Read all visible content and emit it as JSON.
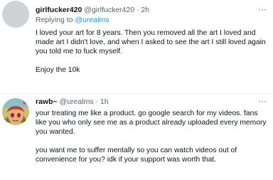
{
  "tweet1": {
    "display_name": "girlfucker420",
    "handle": "@girlfucker420",
    "separator": "·",
    "time": "2h",
    "replying_prefix": "Replying to",
    "replying_to": "@urealms",
    "paragraphs": [
      "I loved your art for 8 years. Then you removed all the art I loved and made art I didn't love, and when I asked to see the art I still loved again you told me to fuck myself.",
      "Enjoy the 10k"
    ]
  },
  "tweet2": {
    "display_name": "rawb~",
    "handle": "@urealms",
    "separator": "·",
    "time": "1h",
    "paragraphs": [
      "your treating me like a product. go google search for my videos. fans like you who only see me as a product already uploaded every memory you wanted.",
      "you want me to suffer mentally so you can watch videos out of convenience for you? idk if your support was worth that."
    ]
  },
  "icons": {
    "more": "more-horizontal-icon"
  },
  "colors": {
    "text": "#0f1419",
    "secondary": "#536471",
    "link": "#1d9bf0",
    "divider": "#eff3f4"
  }
}
